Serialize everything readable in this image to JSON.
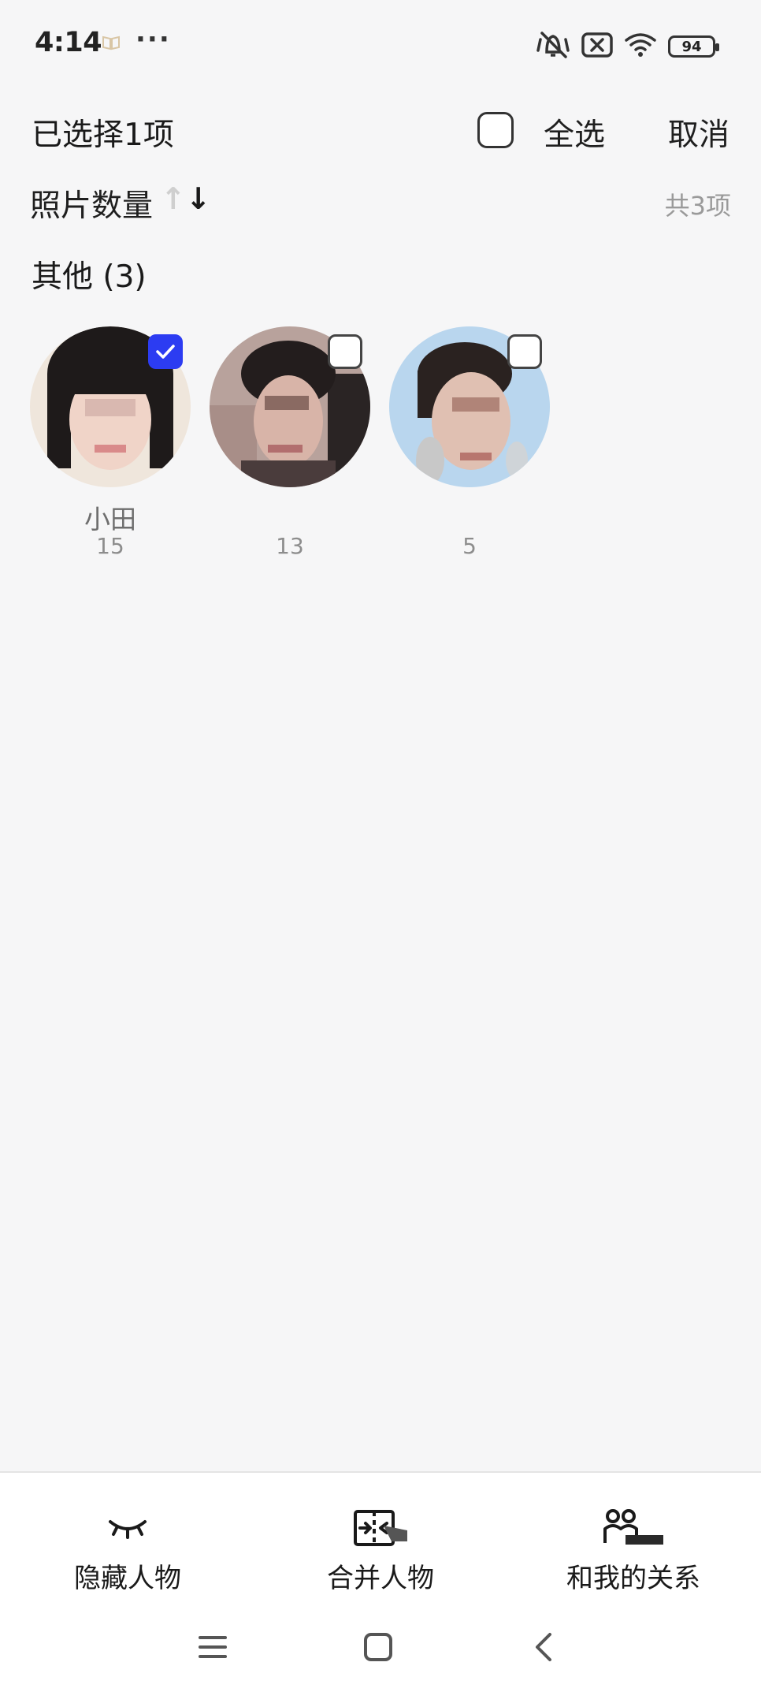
{
  "status_bar": {
    "time": "4:14",
    "book_icon": "book-icon",
    "dots": "···",
    "battery_level": "94"
  },
  "header": {
    "selected_count": "已选择1项",
    "select_all": "全选",
    "cancel": "取消"
  },
  "sort": {
    "label": "照片数量",
    "icon_up": "↑",
    "icon_down": "↓",
    "total": "共3项"
  },
  "section": {
    "title": "其他 (3)"
  },
  "people": [
    {
      "name": "小田",
      "count": "15",
      "selected": true
    },
    {
      "name": "",
      "count": "13",
      "selected": false
    },
    {
      "name": "",
      "count": "5",
      "selected": false
    }
  ],
  "toolbar": {
    "hide": "隐藏人物",
    "merge": "合并人物",
    "relation": "和我的关系"
  },
  "colors": {
    "accent": "#2c3cf2",
    "background": "#f6f6f7"
  }
}
